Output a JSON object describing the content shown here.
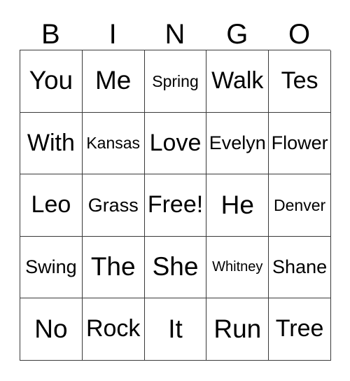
{
  "card": {
    "headers": [
      "B",
      "I",
      "N",
      "G",
      "O"
    ],
    "free_space_label": "Free!",
    "rows": [
      [
        {
          "text": "You",
          "size": "xl"
        },
        {
          "text": "Me",
          "size": "xl"
        },
        {
          "text": "Spring",
          "size": "sm"
        },
        {
          "text": "Walk",
          "size": "lg"
        },
        {
          "text": "Tes",
          "size": "lg"
        }
      ],
      [
        {
          "text": "With",
          "size": "lg"
        },
        {
          "text": "Kansas",
          "size": "sm"
        },
        {
          "text": "Love",
          "size": "lg"
        },
        {
          "text": "Evelyn",
          "size": "md"
        },
        {
          "text": "Flower",
          "size": "md"
        }
      ],
      [
        {
          "text": "Leo",
          "size": "lg"
        },
        {
          "text": "Grass",
          "size": "md"
        },
        {
          "text": "Free!",
          "size": "lg"
        },
        {
          "text": "He",
          "size": "xl"
        },
        {
          "text": "Denver",
          "size": "sm"
        }
      ],
      [
        {
          "text": "Swing",
          "size": "md"
        },
        {
          "text": "The",
          "size": "xl"
        },
        {
          "text": "She",
          "size": "xl"
        },
        {
          "text": "Whitney",
          "size": "xs"
        },
        {
          "text": "Shane",
          "size": "md"
        }
      ],
      [
        {
          "text": "No",
          "size": "xl"
        },
        {
          "text": "Rock",
          "size": "lg"
        },
        {
          "text": "It",
          "size": "xl"
        },
        {
          "text": "Run",
          "size": "xl"
        },
        {
          "text": "Tree",
          "size": "lg"
        }
      ]
    ]
  },
  "colors": {
    "background": "#ffffff",
    "text": "#000000",
    "grid_line": "#3a3a3a"
  }
}
